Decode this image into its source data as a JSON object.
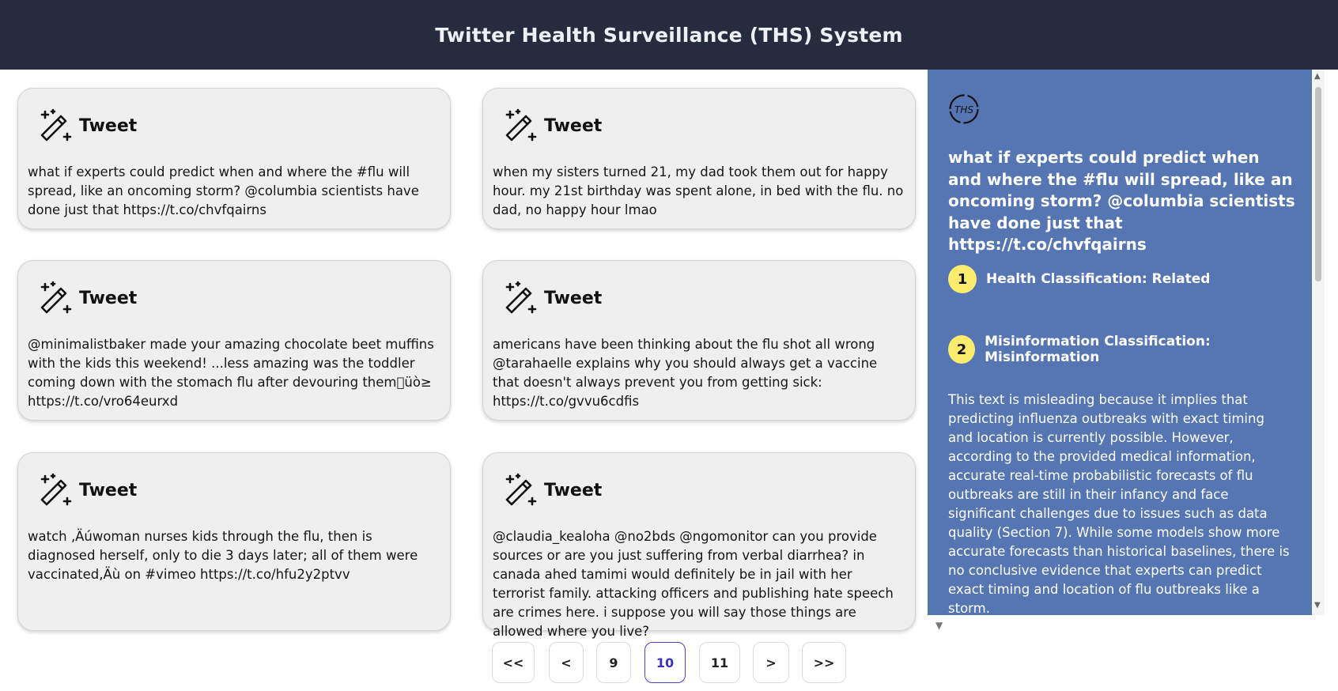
{
  "header": {
    "title": "Twitter Health Surveillance (THS) System"
  },
  "card_title": "Tweet",
  "tweets": [
    {
      "text": "what if experts could predict when and where the #flu will spread, like an oncoming storm? @columbia scientists have done just that https://t.co/chvfqairns"
    },
    {
      "text": "when my sisters turned 21, my dad took them out for happy hour. my 21st birthday was spent alone, in bed with the flu. no dad, no happy hour lmao"
    },
    {
      "text": "@minimalistbaker made your amazing chocolate beet muffins with the kids this weekend! ...less amazing was the toddler coming down with the stomach flu after devouring them\u0000üò≥ https://t.co/vro64eurxd"
    },
    {
      "text": "americans have been thinking about the flu shot all wrong @tarahaelle explains why you should always get a vaccine that doesn't always prevent you from getting sick: https://t.co/gvvu6cdfis"
    },
    {
      "text": "watch ‚Äúwoman nurses kids through the flu, then is diagnosed herself, only to die 3 days later; all of them were vaccinated‚Äù on #vimeo https://t.co/hfu2y2ptvv"
    },
    {
      "text": "@claudia_kealoha @no2bds @ngomonitor can you provide sources or are you just suffering from verbal diarrhea? in canada ahed tamimi would definitely be in jail with her terrorist family. attacking officers and publishing hate speech are crimes here. i suppose you will say those things are allowed where you live?"
    }
  ],
  "pagination": {
    "first": "<<",
    "prev": "<",
    "pages": [
      "9",
      "10",
      "11"
    ],
    "current": "10",
    "next": ">",
    "last": ">>"
  },
  "sidebar": {
    "logo_text": "THS",
    "tweet": "what if experts could predict when and where the #flu will spread, like an oncoming storm? @columbia scientists have done just that https://t.co/chvfqairns",
    "steps": [
      {
        "num": "1",
        "label": "Health Classification: Related"
      },
      {
        "num": "2",
        "label": "Misinformation Classification: Misinformation"
      }
    ],
    "explanation": "This text is misleading because it implies that predicting influenza outbreaks with exact timing and location is currently possible. However, according to the provided medical information, accurate real-time probabilistic forecasts of flu outbreaks are still in their infancy and face significant challenges due to issues such as data quality (Section 7). While some models show more accurate forecasts than historical baselines, there is no conclusive evidence that experts can predict exact timing and location of flu outbreaks like a storm.",
    "accent_color": "#5676b3",
    "badge_color": "#fcec6e"
  }
}
